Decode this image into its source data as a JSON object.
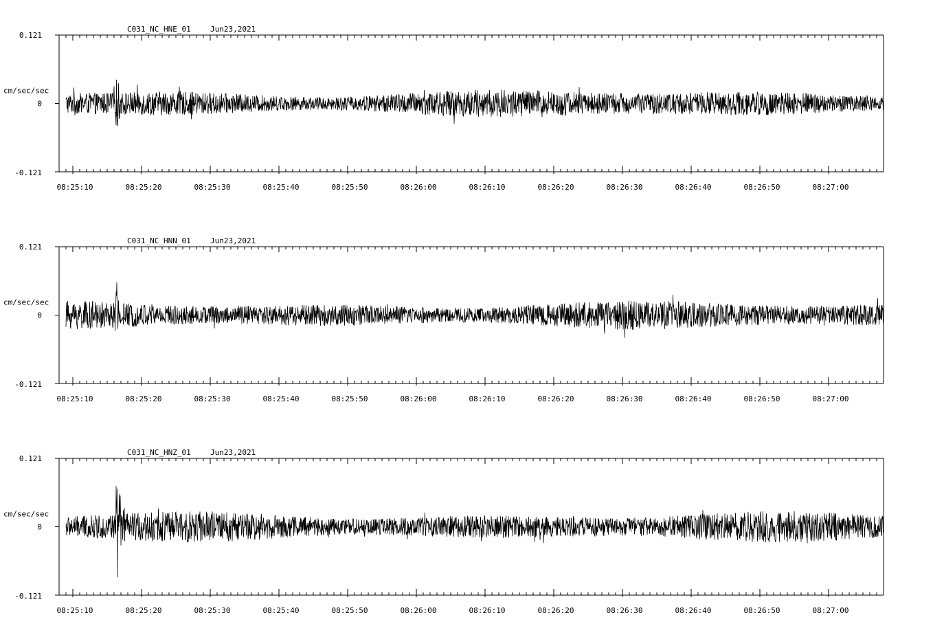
{
  "chart_data": [
    {
      "type": "line",
      "title": "C031_NC_HNE_01",
      "date": "Jun23,2021",
      "ylabel": "cm/sec/sec",
      "ylim": [
        -0.121,
        0.121
      ],
      "yticks": [
        "0.121",
        "0",
        "-0.121"
      ],
      "xticks": [
        "08:25:10",
        "08:25:20",
        "08:25:30",
        "08:25:40",
        "08:25:50",
        "08:26:00",
        "08:26:10",
        "08:26:20",
        "08:26:30",
        "08:26:40",
        "08:26:50",
        "08:27:00"
      ],
      "x_start_seconds_before_first_tick": 1,
      "x_end_seconds_after_last_tick": 8,
      "noise_amplitude": 0.017,
      "events": [
        {
          "time": "08:25:16.4",
          "amplitude": 0.058
        },
        {
          "time": "08:25:25.5",
          "amplitude": 0.03
        },
        {
          "time": "08:26:07.0",
          "amplitude": 0.025
        }
      ],
      "grid": false
    },
    {
      "type": "line",
      "title": "C031_NC_HNN_01",
      "date": "Jun23,2021",
      "ylabel": "cm/sec/sec",
      "ylim": [
        -0.121,
        0.121
      ],
      "yticks": [
        "0.121",
        "0",
        "-0.121"
      ],
      "xticks": [
        "08:25:10",
        "08:25:20",
        "08:25:30",
        "08:25:40",
        "08:25:50",
        "08:26:00",
        "08:26:10",
        "08:26:20",
        "08:26:30",
        "08:26:40",
        "08:26:50",
        "08:27:00"
      ],
      "x_start_seconds_before_first_tick": 1,
      "x_end_seconds_after_last_tick": 8,
      "noise_amplitude": 0.017,
      "events": [
        {
          "time": "08:25:16.4",
          "amplitude": 0.065
        },
        {
          "time": "08:25:30.5",
          "amplitude": 0.03
        },
        {
          "time": "08:26:39.5",
          "amplitude": 0.03
        }
      ],
      "grid": false
    },
    {
      "type": "line",
      "title": "C031_NC_HNZ_01",
      "date": "Jun23,2021",
      "ylabel": "cm/sec/sec",
      "ylim": [
        -0.121,
        0.121
      ],
      "yticks": [
        "0.121",
        "0",
        "-0.121"
      ],
      "xticks": [
        "08:25:10",
        "08:25:20",
        "08:25:30",
        "08:25:40",
        "08:25:50",
        "08:26:00",
        "08:26:10",
        "08:26:20",
        "08:26:30",
        "08:26:40",
        "08:26:50",
        "08:27:00"
      ],
      "x_start_seconds_before_first_tick": 1,
      "x_end_seconds_after_last_tick": 8,
      "noise_amplitude": 0.018,
      "events": [
        {
          "time": "08:25:16.4",
          "amplitude": 0.121
        },
        {
          "time": "08:25:17.5",
          "amplitude": 0.04
        },
        {
          "time": "08:25:30.5",
          "amplitude": 0.03
        },
        {
          "time": "08:26:56.0",
          "amplitude": 0.03
        }
      ],
      "grid": false
    }
  ]
}
